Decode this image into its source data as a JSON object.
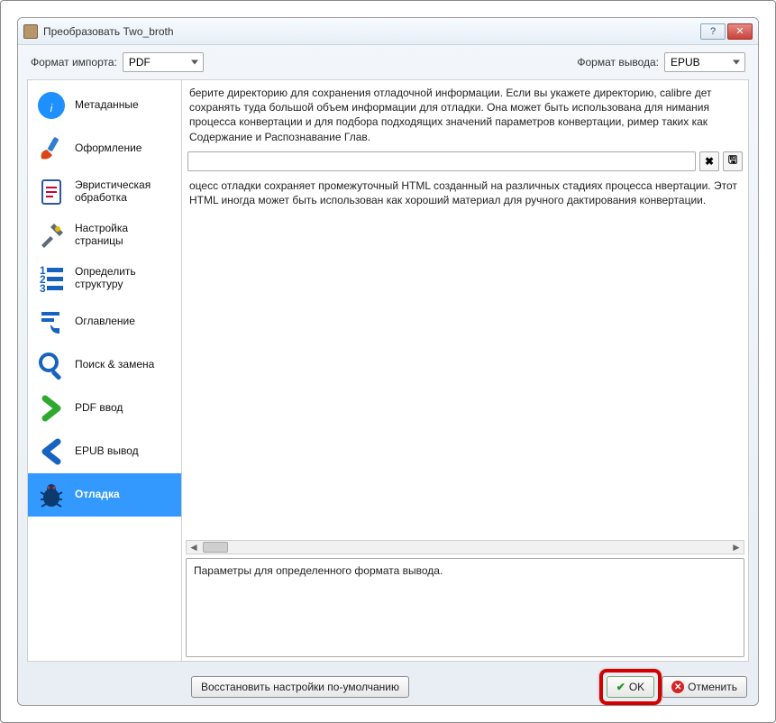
{
  "window": {
    "title": "Преобразовать Two_broth"
  },
  "format": {
    "import_label": "Формат импорта:",
    "import_value": "PDF",
    "output_label": "Формат вывода:",
    "output_value": "EPUB"
  },
  "sidebar": {
    "items": [
      {
        "id": "metadata",
        "label": "Метаданные"
      },
      {
        "id": "look",
        "label": "Оформление"
      },
      {
        "id": "heuristic",
        "label": "Эвристическая обработка"
      },
      {
        "id": "page",
        "label": "Настройка страницы"
      },
      {
        "id": "structure",
        "label": "Определить структуру"
      },
      {
        "id": "toc",
        "label": "Оглавление"
      },
      {
        "id": "search",
        "label": "Поиск & замена"
      },
      {
        "id": "pdfin",
        "label": "PDF ввод"
      },
      {
        "id": "epubout",
        "label": "EPUB вывод"
      },
      {
        "id": "debug",
        "label": "Отладка"
      }
    ],
    "selected": "debug"
  },
  "debug": {
    "desc1": "берите директорию для сохранения отладочной информации. Если вы укажете директорию, calibre дет сохранять туда большой объем информации для отладки. Она может быть использована для нимания процесса конвертации и для подбора подходящих значений параметров конвертации, ример таких как Содержание и Распознавание Глав.",
    "path_value": "",
    "desc2": "оцесс отладки сохраняет промежуточный HTML созданный на различных стадиях процесса нвертации. Этот HTML иногда может быть использован как хороший материал для ручного дактирования конвертации.",
    "hint": "Параметры для определенного формата вывода.",
    "clear_glyph": "✖",
    "browse_glyph": "🖫"
  },
  "buttons": {
    "restore": "Восстановить настройки по-умолчанию",
    "ok": "OK",
    "cancel": "Отменить"
  }
}
